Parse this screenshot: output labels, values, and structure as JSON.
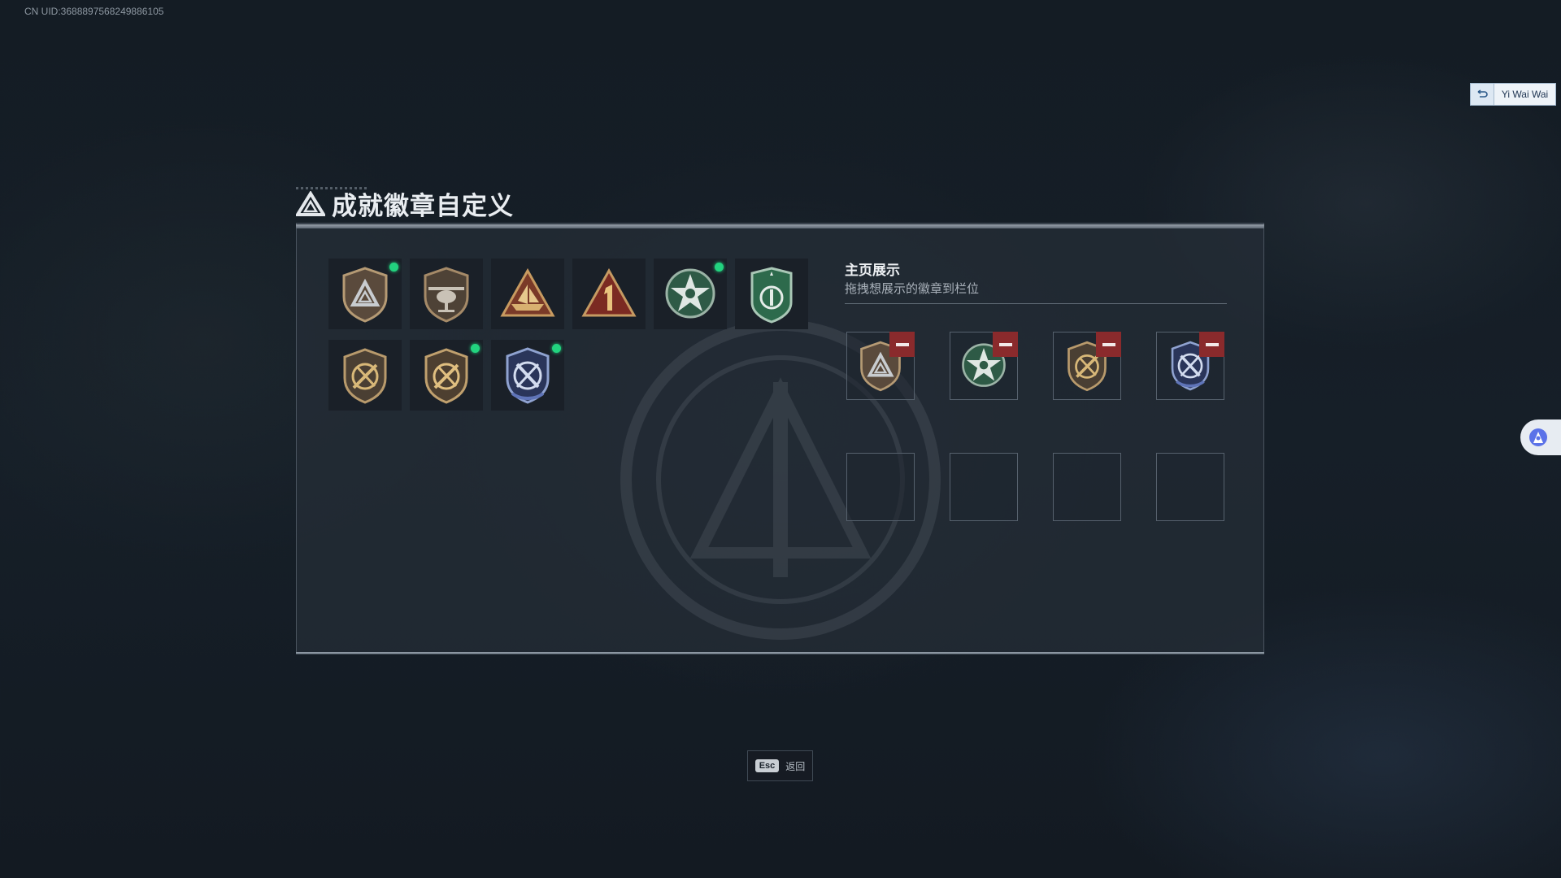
{
  "uid": "CN UID:3688897568249886105",
  "user": {
    "name": "Yi Wai Wai"
  },
  "header": {
    "title": "成就徽章自定义"
  },
  "badges": [
    {
      "icon": "triangle-shield-badge-icon",
      "is_new": true
    },
    {
      "icon": "helicopter-shield-badge-icon",
      "is_new": false
    },
    {
      "icon": "boat-triangle-badge-icon",
      "is_new": false
    },
    {
      "icon": "number-one-triangle-badge-icon",
      "is_new": false
    },
    {
      "icon": "green-star-medal-badge-icon",
      "is_new": true
    },
    {
      "icon": "green-shield-badge-icon",
      "is_new": false
    },
    {
      "icon": "crossed-rifle-shield-badge-icon",
      "is_new": false
    },
    {
      "icon": "crossed-rifle-shield-badge-2-icon",
      "is_new": true
    },
    {
      "icon": "blue-crest-badge-icon",
      "is_new": true
    }
  ],
  "showcase": {
    "title": "主页展示",
    "subtitle": "拖拽想展示的徽章到栏位",
    "slots": [
      {
        "icon": "triangle-shield-badge-icon",
        "filled": true
      },
      {
        "icon": "green-star-medal-badge-icon",
        "filled": true
      },
      {
        "icon": "crossed-rifle-shield-badge-icon",
        "filled": true
      },
      {
        "icon": "blue-crest-badge-icon",
        "filled": true
      },
      {
        "filled": false
      },
      {
        "filled": false
      },
      {
        "filled": false
      },
      {
        "filled": false
      }
    ]
  },
  "footer": {
    "esc_key": "Esc",
    "esc_label": "返回"
  },
  "colors": {
    "new_dot": "#22d37f",
    "remove": "#8a2a2c",
    "panel": "#262e38"
  }
}
